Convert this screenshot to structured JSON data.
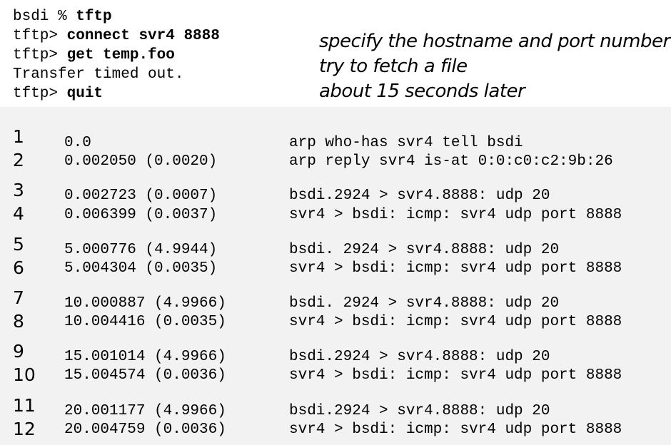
{
  "terminal": {
    "lines": [
      {
        "prompt": "bsdi % ",
        "command": "tftp"
      },
      {
        "prompt": "tftp> ",
        "command": "connect svr4 8888"
      },
      {
        "prompt": "tftp> ",
        "command": "get temp.foo"
      },
      {
        "prompt": "Transfer timed out.",
        "command": ""
      },
      {
        "prompt": "tftp> ",
        "command": "quit"
      }
    ],
    "notes": [
      "specify the hostname and port number",
      "try to fetch a file",
      "about 15 seconds later"
    ]
  },
  "trace": [
    {
      "num": "1",
      "time": "0.0",
      "desc": "arp who-has svr4 tell bsdi"
    },
    {
      "num": "2",
      "time": "0.002050 (0.0020)",
      "desc": "arp reply svr4 is-at 0:0:c0:c2:9b:26"
    },
    {
      "num": "3",
      "time": "0.002723 (0.0007)",
      "desc": "bsdi.2924 > svr4.8888: udp 20"
    },
    {
      "num": "4",
      "time": "0.006399 (0.0037)",
      "desc": "svr4 > bsdi: icmp: svr4 udp port 8888"
    },
    {
      "num": "5",
      "time": "5.000776 (4.9944)",
      "desc": "bsdi. 2924 > svr4.8888: udp 20"
    },
    {
      "num": "6",
      "time": "5.004304 (0.0035)",
      "desc": "svr4 > bsdi: icmp: svr4 udp port 8888"
    },
    {
      "num": "7",
      "time": "10.000887 (4.9966)",
      "desc": "bsdi. 2924 > svr4.8888: udp 20"
    },
    {
      "num": "8",
      "time": "10.004416 (0.0035)",
      "desc": "svr4 > bsdi: icmp: svr4 udp port 8888"
    },
    {
      "num": "9",
      "time": "15.001014 (4.9966)",
      "desc": "bsdi.2924 > svr4.8888: udp 20"
    },
    {
      "num": "10",
      "time": "15.004574 (0.0036)",
      "desc": "svr4 > bsdi: icmp: svr4 udp port 8888"
    },
    {
      "num": "11",
      "time": "20.001177 (4.9966)",
      "desc": "bsdi.2924 > svr4.8888: udp 20"
    },
    {
      "num": "12",
      "time": "20.004759 (0.0036)",
      "desc": "svr4 > bsdi: icmp: svr4 udp port 8888"
    }
  ]
}
